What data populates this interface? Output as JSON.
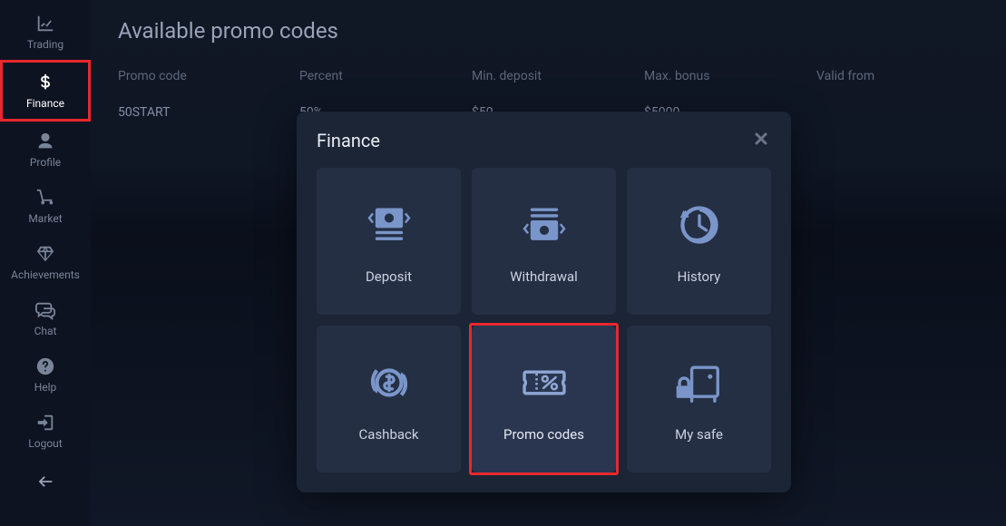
{
  "sidebar": {
    "items": [
      {
        "label": "Trading"
      },
      {
        "label": "Finance"
      },
      {
        "label": "Profile"
      },
      {
        "label": "Market"
      },
      {
        "label": "Achievements"
      },
      {
        "label": "Chat"
      },
      {
        "label": "Help"
      },
      {
        "label": "Logout"
      }
    ]
  },
  "page": {
    "title": "Available promo codes",
    "columns": {
      "code": "Promo code",
      "percent": "Percent",
      "min_deposit": "Min. deposit",
      "max_bonus": "Max. bonus",
      "valid_from": "Valid from"
    },
    "rows": [
      {
        "code": "50START",
        "percent": "50%",
        "min_deposit": "$50",
        "max_bonus": "$5000",
        "valid_from": ""
      }
    ]
  },
  "modal": {
    "title": "Finance",
    "tiles": {
      "deposit": "Deposit",
      "withdrawal": "Withdrawal",
      "history": "History",
      "cashback": "Cashback",
      "promo_codes": "Promo codes",
      "my_safe": "My safe"
    }
  }
}
